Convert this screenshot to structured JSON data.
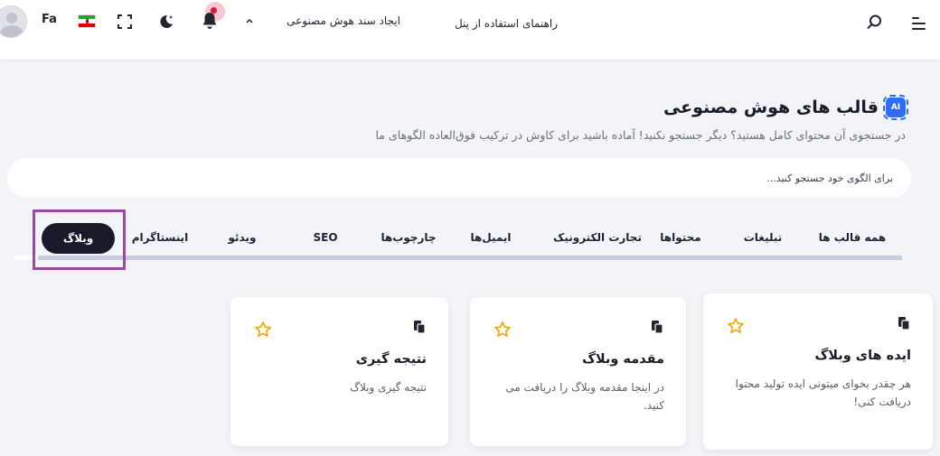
{
  "header": {
    "lang": "Fa",
    "ai_doc": "ایجاد سند هوش مصنوعی",
    "guide": "راهنمای استفاده از پنل",
    "icons": [
      "avatar",
      "iran-flag-icon",
      "fullscreen-icon",
      "moon-icon",
      "bell-icon",
      "chevron-up-icon",
      "search-icon",
      "menu-icon"
    ]
  },
  "page": {
    "badge": "AI",
    "title": "قالب های هوش مصنوعی",
    "subtitle": "در جستجوی آن محتوای کامل هستید؟ دیگر جستجو نکنید! آماده باشید برای کاوش در ترکیب فوق‌العاده الگوهای ما"
  },
  "search": {
    "placeholder": "برای الگوی خود جستجو کنید..."
  },
  "tabs": {
    "items": [
      "همه قالب ها",
      "تبلیغات",
      "محتواها",
      "تجارت الکترونیک",
      "ایمیل‌ها",
      "چارچوب‌ها",
      "SEO",
      "ویدئو",
      "اینستاگرام"
    ],
    "active": "وبلاگ"
  },
  "cards": [
    {
      "title": "ایده های وبلاگ",
      "desc": "هر چقدر بخوای میتونی ایده تولید محتوا دریافت کنی!"
    },
    {
      "title": "مقدمه وبلاگ",
      "desc": "در اینجا مقدمه وبلاگ را دریافت می کنید."
    },
    {
      "title": "نتیجه گیری",
      "desc": "نتیجه گیری وبلاگ"
    }
  ],
  "colors": {
    "accent": "#2f6df6",
    "active_tab": "#181b2a",
    "star": "#f0a500",
    "highlight": "#9b4aa2",
    "notification": "#e2143c"
  }
}
